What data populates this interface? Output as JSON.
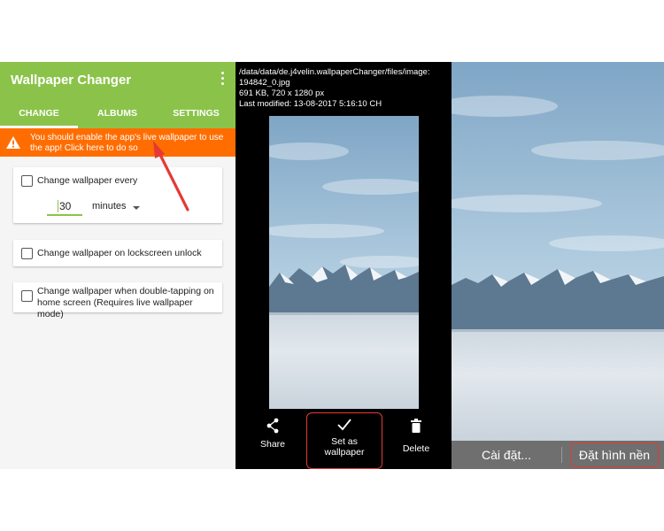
{
  "app": {
    "title": "Wallpaper Changer",
    "tabs": [
      {
        "label": "CHANGE",
        "active": true
      },
      {
        "label": "ALBUMS",
        "active": false
      },
      {
        "label": "SETTINGS",
        "active": false
      }
    ],
    "banner_text": "You should enable the app's live wallpaper to use the app! Click here to do so",
    "options": {
      "every_label": "Change wallpaper every",
      "interval_value": "30",
      "interval_unit": "minutes",
      "lockscreen_label": "Change wallpaper on lockscreen unlock",
      "double_tap_label": "Change wallpaper when double-tapping on home screen (Requires live wallpaper mode)"
    },
    "colors": {
      "accent": "#8bc34a",
      "banner": "#ff6d00",
      "highlight": "#e53935"
    }
  },
  "viewer": {
    "file_path_line1": "/data/data/de.j4velin.wallpaperChanger/files/image:",
    "file_path_line2": "194842_0.jpg",
    "file_meta": "691 KB, 720 x 1280 px",
    "last_modified": "Last modified: 13-08-2017 5:16:10 CH",
    "actions": {
      "share_label": "Share",
      "set_label_line1": "Set as",
      "set_label_line2": "wallpaper",
      "delete_label": "Delete"
    }
  },
  "preview": {
    "settings_label": "Cài đặt...",
    "set_wallpaper_label": "Đặt hình nền"
  }
}
